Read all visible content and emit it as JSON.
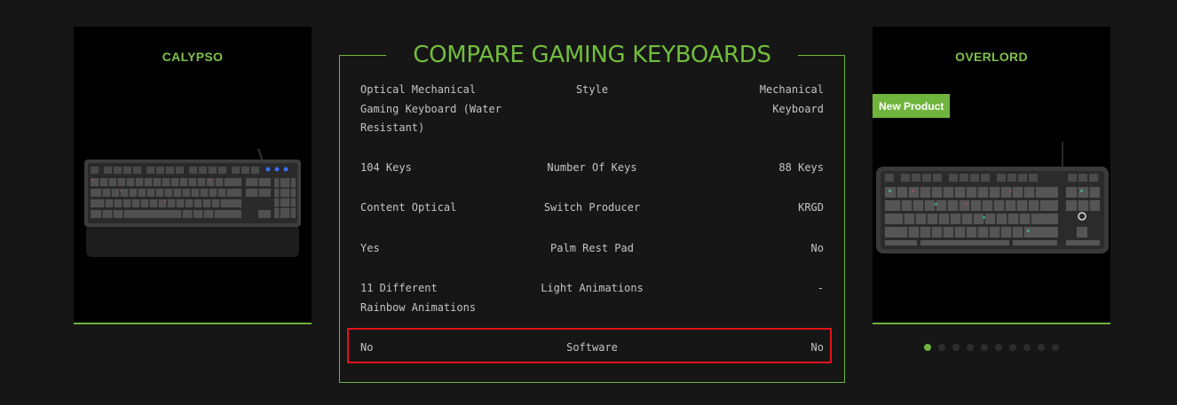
{
  "left_product": {
    "title": "CALYPSO"
  },
  "right_product": {
    "title": "OVERLORD",
    "badge": "New Product"
  },
  "compare": {
    "title": "COMPARE GAMING KEYBOARDS",
    "rows": [
      {
        "left": "Optical Mechanical Gaming Keyboard (Water Resistant)",
        "label": "Style",
        "right": "Mechanical Keyboard"
      },
      {
        "left": "104 Keys",
        "label": "Number Of Keys",
        "right": "88 Keys"
      },
      {
        "left": "Content Optical",
        "label": "Switch Producer",
        "right": "KRGD"
      },
      {
        "left": "Yes",
        "label": "Palm Rest Pad",
        "right": "No"
      },
      {
        "left": "11 Different Rainbow Animations",
        "label": "Light Animations",
        "right": "-"
      },
      {
        "left": "No",
        "label": "Software",
        "right": "No"
      }
    ]
  },
  "carousel": {
    "dot_count": 10,
    "active_index": 0
  },
  "colors": {
    "accent": "#6fb43c",
    "highlight": "#e3121b",
    "background": "#161616"
  }
}
